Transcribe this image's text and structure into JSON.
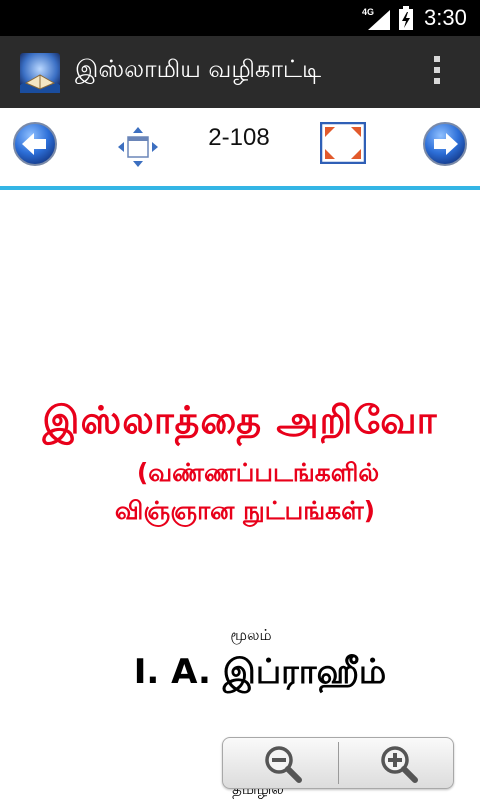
{
  "status_bar": {
    "network": "4G",
    "time": "3:30",
    "icons": [
      "signal-icon",
      "battery-charging-icon"
    ]
  },
  "action_bar": {
    "app_icon": "app-icon",
    "title": "இஸ்லாமிய வழிகாட்டி",
    "overflow_icon": "overflow-menu-icon"
  },
  "toolbar": {
    "prev_icon": "arrow-left-icon",
    "move_icon": "move-icon",
    "page_indicator": "2-108",
    "fullscreen_icon": "fullscreen-icon",
    "next_icon": "arrow-right-icon"
  },
  "page": {
    "title": "இஸ்லாத்தை அறிவோ",
    "subtitle_line1": "(வண்ணப்படங்களில்",
    "subtitle_line2": "விஞ்ஞான நுட்பங்கள்)",
    "source_label": "மூலம்",
    "author": "I. A. இப்ராஹீம்",
    "bottom_text": "தமிழில"
  },
  "zoom": {
    "zoom_out_icon": "zoom-out-icon",
    "zoom_in_icon": "zoom-in-icon"
  },
  "colors": {
    "accent": "#33b5e5",
    "title_red": "#e8001a",
    "action_bar": "#2b2b2b"
  }
}
